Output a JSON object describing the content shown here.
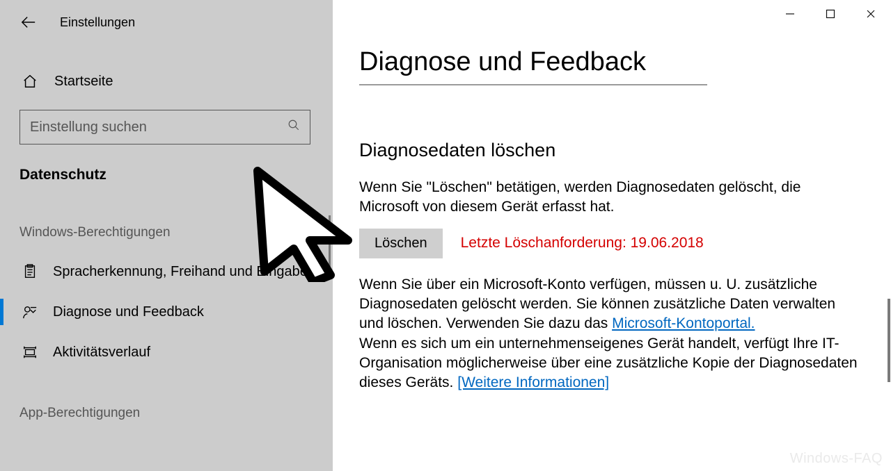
{
  "window": {
    "title": "Einstellungen"
  },
  "sidebar": {
    "home": "Startseite",
    "search_placeholder": "Einstellung suchen",
    "section": "Datenschutz",
    "group1": "Windows-Berechtigungen",
    "group2": "App-Berechtigungen",
    "items": [
      {
        "icon": "clipboard",
        "label": "Spracherkennung, Freihand und Eingabe"
      },
      {
        "icon": "feedback",
        "label": "Diagnose und Feedback"
      },
      {
        "icon": "history",
        "label": "Aktivitätsverlauf"
      }
    ]
  },
  "main": {
    "title": "Diagnose und Feedback",
    "section_title": "Diagnosedaten löschen",
    "intro": "Wenn Sie \"Löschen\" betätigen, werden Diagnosedaten gelöscht, die Microsoft von diesem Gerät erfasst hat.",
    "delete_button": "Löschen",
    "last_delete": "Letzte Löschanforderung: 19.06.2018",
    "para2a": "Wenn Sie über ein Microsoft-Konto verfügen, müssen u. U. zusätzliche Diagnosedaten gelöscht werden. Sie können zusätzliche Daten verwalten und löschen. Verwenden Sie dazu das ",
    "link1": "Microsoft-Kontoportal.",
    "para2b": "Wenn es sich um ein unternehmenseigenes Gerät handelt, verfügt Ihre IT-Organisation möglicherweise über eine zusätzliche Kopie der Diagnosedaten dieses Geräts. ",
    "link2": "[Weitere Informationen]"
  },
  "watermark": "Windows-FAQ"
}
